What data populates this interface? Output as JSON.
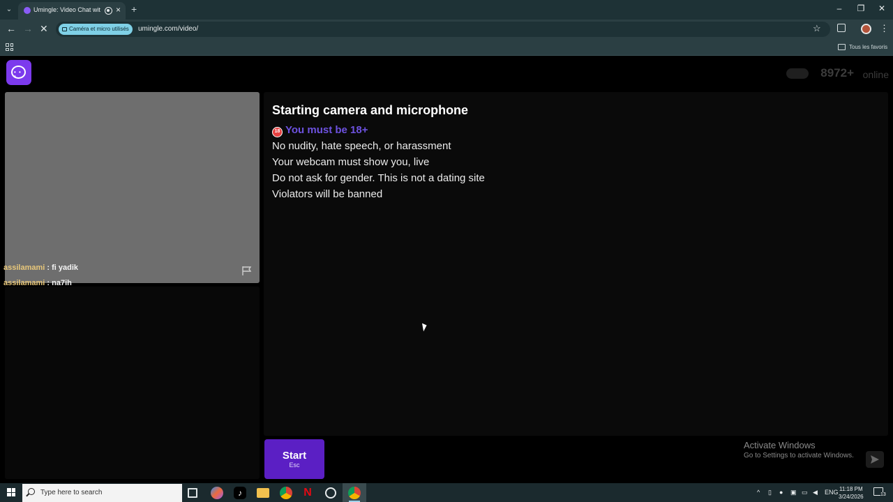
{
  "browser": {
    "tab_title": "Umingle: Video Chat with S",
    "permission_chip": "Caméra et micro utilisés",
    "url": "umingle.com/video/",
    "bookmarks_label": "Tous les favoris"
  },
  "site": {
    "online_count": "8972+",
    "online_label": "online"
  },
  "chat": [
    {
      "user": "assilamami",
      "sep": " : ",
      "text": "fi yadik"
    },
    {
      "user": "assilamami",
      "sep": " : ",
      "text": "na7ih"
    }
  ],
  "main": {
    "title": "Starting camera and microphone",
    "age_badge": "18",
    "age_text": "You must be 18+",
    "rules": [
      "No nudity, hate speech, or harassment",
      "Your webcam must show you, live",
      "Do not ask for gender. This is not a dating site",
      "Violators will be banned"
    ]
  },
  "controls": {
    "start_label": "Start",
    "start_hint": "Esc"
  },
  "watermark": {
    "title": "Activate Windows",
    "subtitle": "Go to Settings to activate Windows."
  },
  "taskbar": {
    "search_placeholder": "Type here to search",
    "language": "ENG",
    "time": "11:18 PM",
    "date": "3/24/2026",
    "notification_count": "13"
  },
  "colors": {
    "accent": "#7c3aed",
    "start_button": "#5b1fc4",
    "age_text": "#6d52e0",
    "username": "#e8c77a"
  }
}
